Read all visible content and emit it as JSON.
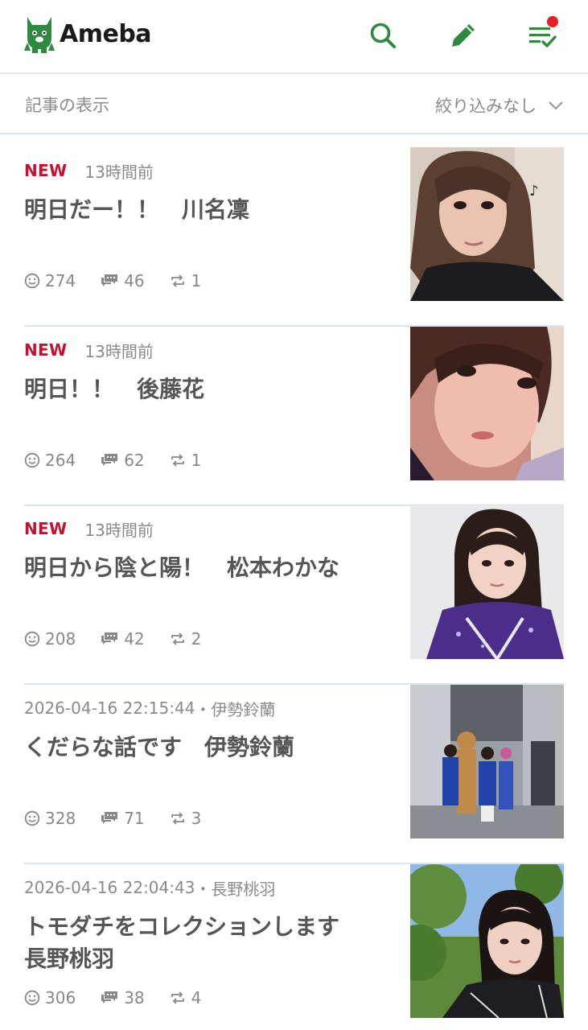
{
  "header": {
    "logo_text": "Ameba",
    "brand_color": "#2d8a3e",
    "icons": [
      "search-icon",
      "pencil-icon",
      "feed-check-icon"
    ],
    "notification_dot_color": "#e52222"
  },
  "filter": {
    "label": "記事の表示",
    "selected": "絞り込みなし"
  },
  "articles": [
    {
      "badge": "NEW",
      "time": "13時間前",
      "title": "明日だー！！　川名凜",
      "likes": "274",
      "comments": "46",
      "reblogs": "1",
      "thumbnail": "selfie-photo"
    },
    {
      "badge": "NEW",
      "time": "13時間前",
      "title": "明日！！　後藤花",
      "likes": "264",
      "comments": "62",
      "reblogs": "1",
      "thumbnail": "selfie-photo"
    },
    {
      "badge": "NEW",
      "time": "13時間前",
      "title": "明日から陰と陽！　松本わかな",
      "likes": "208",
      "comments": "42",
      "reblogs": "2",
      "thumbnail": "portrait-photo"
    },
    {
      "date": "2026-04-16 22:15:44",
      "author": "伊勢鈴蘭",
      "title": "くだらな話です　伊勢鈴蘭",
      "likes": "328",
      "comments": "71",
      "reblogs": "3",
      "thumbnail": "backstage-photo"
    },
    {
      "date": "2026-04-16 22:04:43",
      "author": "長野桃羽",
      "title": "トモダチをコレクションします　長野桃羽",
      "likes": "306",
      "comments": "38",
      "reblogs": "4",
      "thumbnail": "outdoor-portrait-photo"
    }
  ],
  "meta_separator": "・",
  "colors": {
    "new_badge": "#c8102e",
    "divider": "#d9e6ef",
    "muted_text": "#8a8a8a"
  }
}
